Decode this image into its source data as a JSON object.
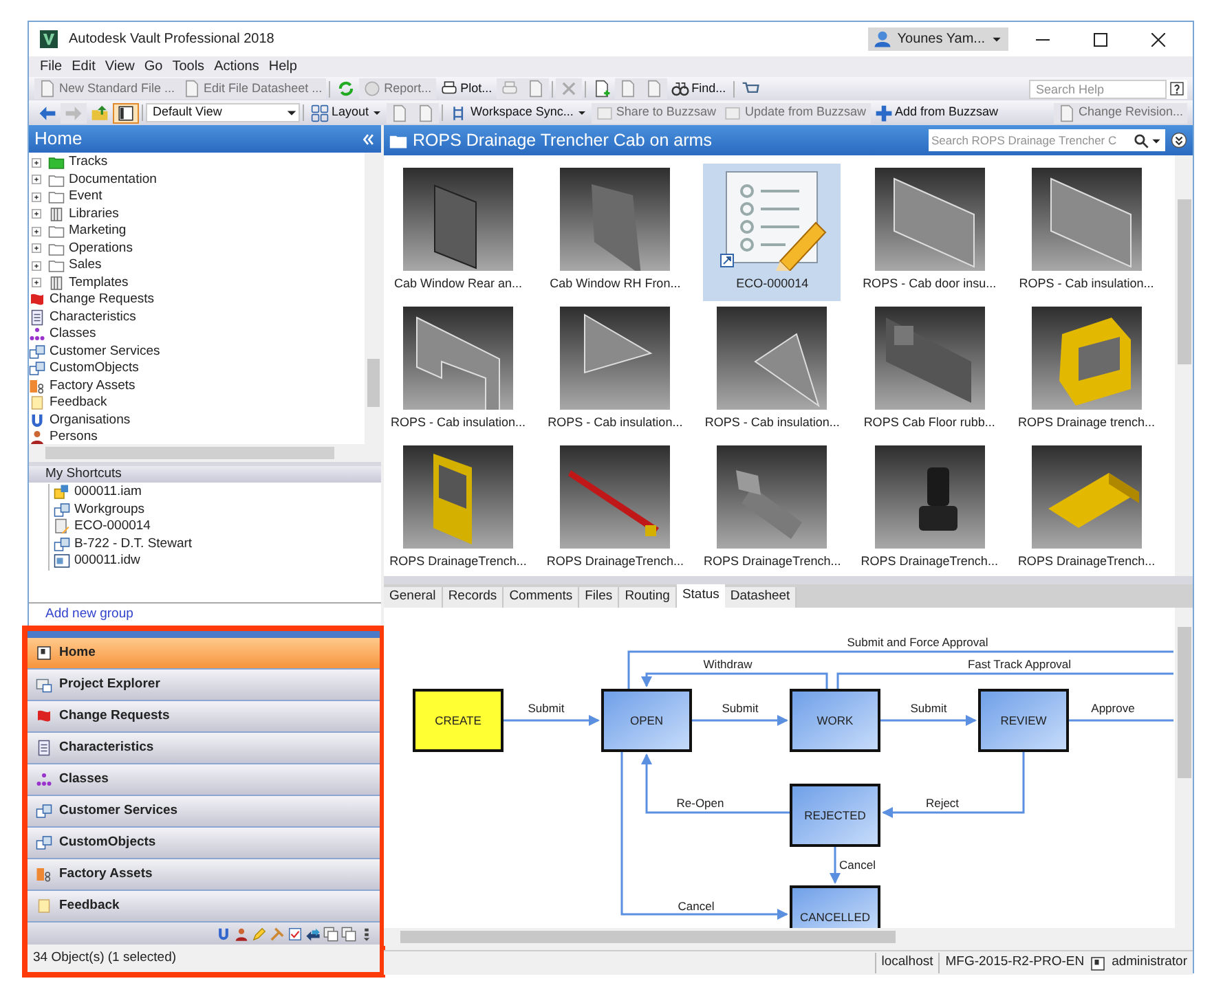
{
  "window": {
    "title": "Autodesk Vault Professional 2018",
    "user": "Younes Yam..."
  },
  "menu": [
    "File",
    "Edit",
    "View",
    "Go",
    "Tools",
    "Actions",
    "Help"
  ],
  "toolbar_1": {
    "groups": [
      [
        {
          "label": "New Standard File ...",
          "disabled": true
        },
        {
          "label": "Edit File Datasheet ...",
          "disabled": true
        }
      ],
      [
        {
          "disabled": false
        },
        {
          "label": "Report...",
          "disabled": true
        },
        {
          "label": "Plot...",
          "disabled": false
        },
        {
          "disabled": true
        },
        {
          "disabled": true
        }
      ],
      [
        {
          "disabled": true
        }
      ],
      [
        {
          "disabled": false
        },
        {
          "disabled": true
        },
        {
          "disabled": true
        },
        {
          "label": "Find...",
          "disabled": false
        }
      ],
      [
        {
          "disabled": false
        }
      ]
    ],
    "search_help": {
      "placeholder": "Search Help"
    }
  },
  "toolbar_2": {
    "groups": [
      [
        {
          "disabled": false,
          "pressed": false
        },
        {
          "disabled": true,
          "pressed": false
        },
        {
          "disabled": false,
          "pressed": false
        },
        {
          "disabled": false,
          "pressed": true
        }
      ],
      [
        {
          "kind": "combo",
          "label": "Default View",
          "disabled": false
        }
      ],
      [
        {
          "kind": "menu",
          "label": "Layout",
          "disabled": false
        },
        {
          "disabled": true
        },
        {
          "disabled": true
        }
      ],
      [
        {
          "kind": "menu",
          "label": "Workspace Sync...",
          "disabled": false
        },
        {
          "label": "Share to Buzzsaw",
          "disabled": true
        },
        {
          "label": "Update from Buzzsaw",
          "disabled": true
        },
        {
          "label": "Add from Buzzsaw",
          "disabled": false
        }
      ],
      [
        {
          "label": "Change Revision...",
          "disabled": true
        }
      ]
    ]
  },
  "navigator": {
    "title": "Home",
    "tree": {
      "cut_off_children": [
        {
          "label": "Tracks",
          "kind": "green_folder",
          "expandable": true
        }
      ],
      "items": [
        {
          "label": "Documentation",
          "kind": "folder",
          "expandable": true
        },
        {
          "label": "Event",
          "kind": "folder",
          "expandable": true
        },
        {
          "label": "Libraries",
          "kind": "library",
          "expandable": true
        },
        {
          "label": "Marketing",
          "kind": "folder",
          "expandable": true
        },
        {
          "label": "Operations",
          "kind": "folder",
          "expandable": true
        },
        {
          "label": "Sales",
          "kind": "folder",
          "expandable": true
        },
        {
          "label": "Templates",
          "kind": "library",
          "expandable": true
        },
        {
          "label": "Change Requests",
          "kind": "change_request",
          "expandable": false
        },
        {
          "label": "Characteristics",
          "kind": "characteristic",
          "expandable": false
        },
        {
          "label": "Classes",
          "kind": "class",
          "expandable": false
        },
        {
          "label": "Customer Services",
          "kind": "custom_object",
          "expandable": false
        },
        {
          "label": "CustomObjects",
          "kind": "custom_object",
          "expandable": false
        },
        {
          "label": "Factory Assets",
          "kind": "factory",
          "expandable": false
        },
        {
          "label": "Feedback",
          "kind": "feedback",
          "expandable": false
        },
        {
          "label": "Organisations",
          "kind": "organisation",
          "expandable": false
        },
        {
          "label": "Persons",
          "kind": "person",
          "expandable": false
        }
      ]
    },
    "shortcuts": {
      "title": "My Shortcuts",
      "items": [
        {
          "label": "000011.iam",
          "kind": "assembly"
        },
        {
          "label": "Workgroups",
          "kind": "custom_object"
        },
        {
          "label": "ECO-000014",
          "kind": "eco"
        },
        {
          "label": "B-722 - D.T. Stewart",
          "kind": "custom_object"
        },
        {
          "label": "000011.idw",
          "kind": "drawing"
        }
      ],
      "add_link": "Add new group"
    },
    "buttons": [
      {
        "label": "Home",
        "kind": "home",
        "selected": true
      },
      {
        "label": "Project Explorer",
        "kind": "project",
        "selected": false
      },
      {
        "label": "Change Requests",
        "kind": "change_request",
        "selected": false
      },
      {
        "label": "Characteristics",
        "kind": "characteristic",
        "selected": false
      },
      {
        "label": "Classes",
        "kind": "class",
        "selected": false
      },
      {
        "label": "Customer Services",
        "kind": "custom_object",
        "selected": false
      },
      {
        "label": "CustomObjects",
        "kind": "custom_object",
        "selected": false
      },
      {
        "label": "Factory Assets",
        "kind": "factory",
        "selected": false
      },
      {
        "label": "Feedback",
        "kind": "feedback",
        "selected": false
      }
    ],
    "status": "34 Object(s) (1 selected)"
  },
  "content": {
    "title": "ROPS Drainage Trencher Cab on arms",
    "search": {
      "placeholder": "Search ROPS Drainage Trencher C"
    },
    "items": [
      {
        "label": "Cab Window Rear an...",
        "kind": "model",
        "selected": false
      },
      {
        "label": "Cab Window RH Fron...",
        "kind": "model",
        "selected": false
      },
      {
        "label": "ECO-000014",
        "kind": "document",
        "selected": true
      },
      {
        "label": "ROPS - Cab door insu...",
        "kind": "model",
        "selected": false
      },
      {
        "label": "ROPS - Cab insulation...",
        "kind": "model",
        "selected": false
      },
      {
        "label": "ROPS - Cab insulation...",
        "kind": "model",
        "selected": false
      },
      {
        "label": "ROPS - Cab insulation...",
        "kind": "model",
        "selected": false
      },
      {
        "label": "ROPS - Cab insulation...",
        "kind": "model",
        "selected": false
      },
      {
        "label": "ROPS Cab Floor rubb...",
        "kind": "model",
        "selected": false
      },
      {
        "label": "ROPS Drainage trench...",
        "kind": "model",
        "selected": false
      },
      {
        "label": "ROPS DrainageTrench...",
        "kind": "model",
        "selected": false
      },
      {
        "label": "ROPS DrainageTrench...",
        "kind": "model",
        "selected": false
      },
      {
        "label": "ROPS DrainageTrench...",
        "kind": "model",
        "selected": false
      },
      {
        "label": "ROPS DrainageTrench...",
        "kind": "model",
        "selected": false
      },
      {
        "label": "ROPS DrainageTrench...",
        "kind": "model",
        "selected": false
      }
    ]
  },
  "tabs": [
    {
      "label": "General",
      "selected": false
    },
    {
      "label": "Records",
      "selected": false
    },
    {
      "label": "Comments",
      "selected": false
    },
    {
      "label": "Files",
      "selected": false
    },
    {
      "label": "Routing",
      "selected": false
    },
    {
      "label": "Status",
      "selected": true
    },
    {
      "label": "Datasheet",
      "selected": false
    }
  ],
  "workflow": {
    "nodes": [
      {
        "label": "CREATE",
        "kind": "start"
      },
      {
        "label": "OPEN",
        "kind": "state"
      },
      {
        "label": "WORK",
        "kind": "state"
      },
      {
        "label": "REVIEW",
        "kind": "state"
      },
      {
        "label": "REJECTED",
        "kind": "state"
      },
      {
        "label": "CANCELLED",
        "kind": "state"
      }
    ],
    "edges": [
      {
        "label": "Submit"
      },
      {
        "label": "Submit"
      },
      {
        "label": "Submit"
      },
      {
        "label": "Approve"
      },
      {
        "label": "Submit and Force Approval"
      },
      {
        "label": "Withdraw"
      },
      {
        "label": "Fast Track Approval"
      },
      {
        "label": "Re-Open"
      },
      {
        "label": "Reject"
      },
      {
        "label": "Cancel"
      },
      {
        "label": "Cancel"
      }
    ]
  },
  "status_bar": {
    "server": "localhost",
    "vault": "MFG-2015-R2-PRO-EN",
    "user": "administrator"
  }
}
